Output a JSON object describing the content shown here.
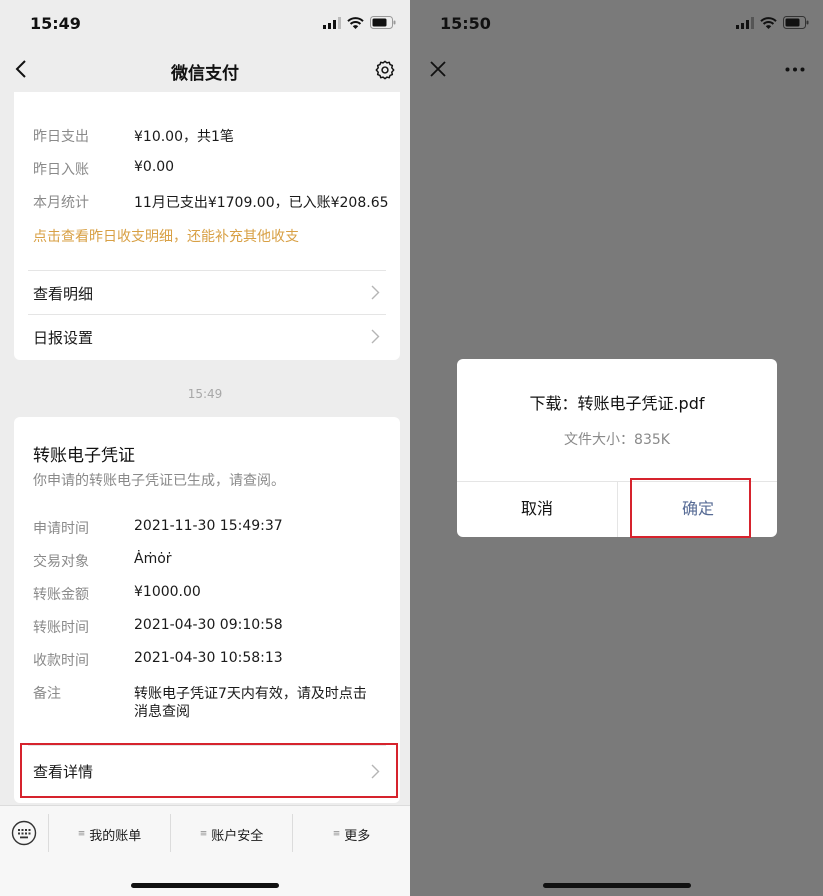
{
  "left": {
    "status_time": "15:49",
    "nav_title": "微信支付",
    "daily": {
      "rows": [
        {
          "label": "昨日支出",
          "value": "¥10.00，共1笔"
        },
        {
          "label": "昨日入账",
          "value": "¥0.00"
        },
        {
          "label": "本月统计",
          "value": "11月已支出¥1709.00，已入账¥208.65"
        }
      ],
      "tip": "点击查看昨日收支明细，还能补充其他收支",
      "links": [
        "查看明细",
        "日报设置"
      ]
    },
    "timestamp": "15:49",
    "voucher": {
      "title": "转账电子凭证",
      "subtitle": "你申请的转账电子凭证已生成，请查阅。",
      "rows": [
        {
          "label": "申请时间",
          "value": "2021-11-30 15:49:37"
        },
        {
          "label": "交易对象",
          "value": "Ȧṁȯṙ"
        },
        {
          "label": "转账金额",
          "value": "¥1000.00"
        },
        {
          "label": "转账时间",
          "value": "2021-04-30 09:10:58"
        },
        {
          "label": "收款时间",
          "value": "2021-04-30 10:58:13"
        }
      ],
      "note_label": "备注",
      "note_line1": "转账电子凭证7天内有效，请及时点击",
      "note_line2": "消息查阅",
      "detail_link": "查看详情"
    },
    "toolbar": [
      "我的账单",
      "账户安全",
      "更多"
    ],
    "highlight_color": "#d6232d",
    "tip_color": "#d8a045"
  },
  "right": {
    "status_time": "15:50",
    "dialog": {
      "title": "下载：转账电子凭证.pdf",
      "size": "文件大小：835K",
      "cancel": "取消",
      "confirm": "确定"
    }
  }
}
